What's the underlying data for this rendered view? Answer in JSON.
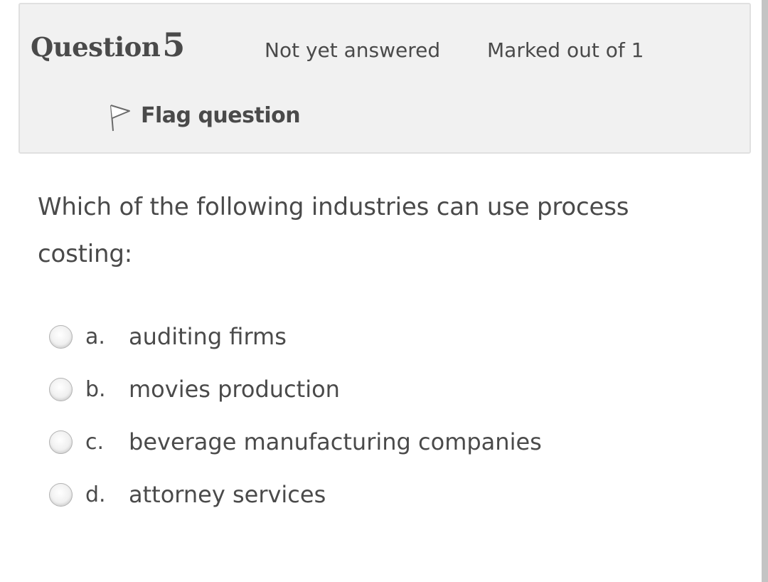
{
  "info": {
    "question_word": "Question",
    "question_number": "5",
    "state": "Not yet answered",
    "grade": "Marked out of 1",
    "flag_label": "Flag question",
    "flag_icon": "flag-outline-icon"
  },
  "question": {
    "text_line1": "Which of the following industries can use process",
    "text_line2": "costing:",
    "options": [
      {
        "letter": "a.",
        "text": "auditing firms"
      },
      {
        "letter": "b.",
        "text": "movies production"
      },
      {
        "letter": "c.",
        "text": "beverage manufacturing companies"
      },
      {
        "letter": "d.",
        "text": "attorney services"
      }
    ]
  },
  "colors": {
    "text": "#4a4a4a",
    "info_bg": "#f1f1f1",
    "info_border": "#e0e0e0",
    "scrollbar": "#c4c4c4"
  }
}
